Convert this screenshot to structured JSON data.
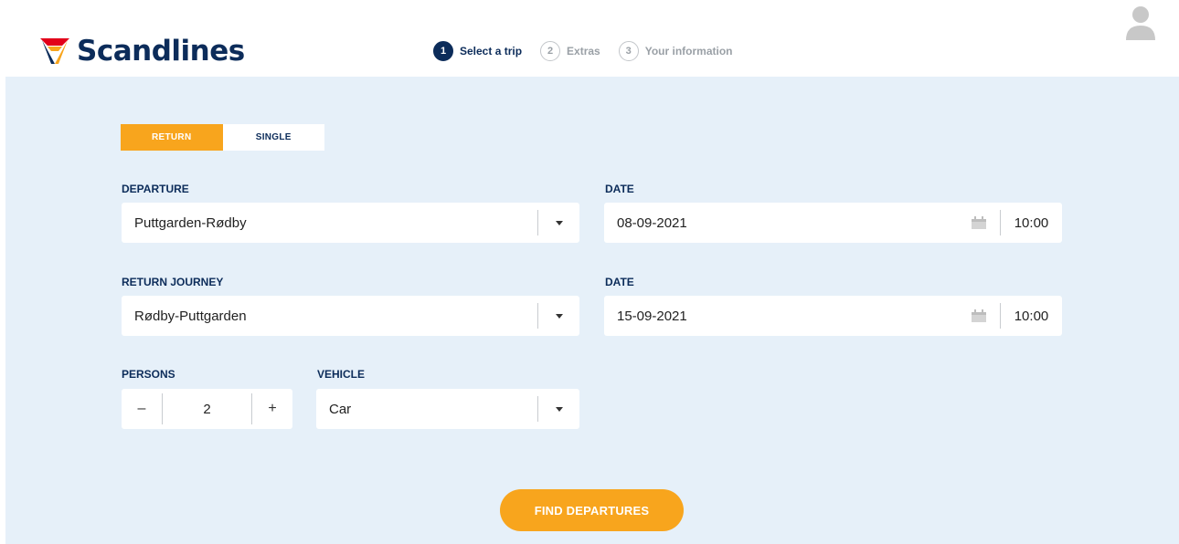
{
  "brand": {
    "name": "Scandlines"
  },
  "steps": [
    {
      "num": "1",
      "label": "Select a trip"
    },
    {
      "num": "2",
      "label": "Extras"
    },
    {
      "num": "3",
      "label": "Your information"
    }
  ],
  "trip_type": {
    "return_label": "RETURN",
    "single_label": "SINGLE",
    "selected": "RETURN"
  },
  "departure": {
    "label": "DEPARTURE",
    "value": "Puttgarden-Rødby"
  },
  "departure_date": {
    "label": "DATE",
    "date": "08-09-2021",
    "time": "10:00"
  },
  "return_journey": {
    "label": "RETURN JOURNEY",
    "value": "Rødby-Puttgarden"
  },
  "return_date": {
    "label": "DATE",
    "date": "15-09-2021",
    "time": "10:00"
  },
  "persons": {
    "label": "PERSONS",
    "value": "2",
    "minus": "–",
    "plus": "+"
  },
  "vehicle": {
    "label": "VEHICLE",
    "value": "Car"
  },
  "find_button": {
    "label": "FIND DEPARTURES"
  },
  "colors": {
    "navy": "#0c2c5a",
    "orange": "#f8a51d",
    "panel": "#e6f0f9",
    "logo_red": "#e2001a"
  },
  "icons": {
    "logo": "scandlines-v-logo-icon",
    "avatar": "user-avatar-icon",
    "calendar": "calendar-icon",
    "dropdown": "caret-down-icon"
  }
}
